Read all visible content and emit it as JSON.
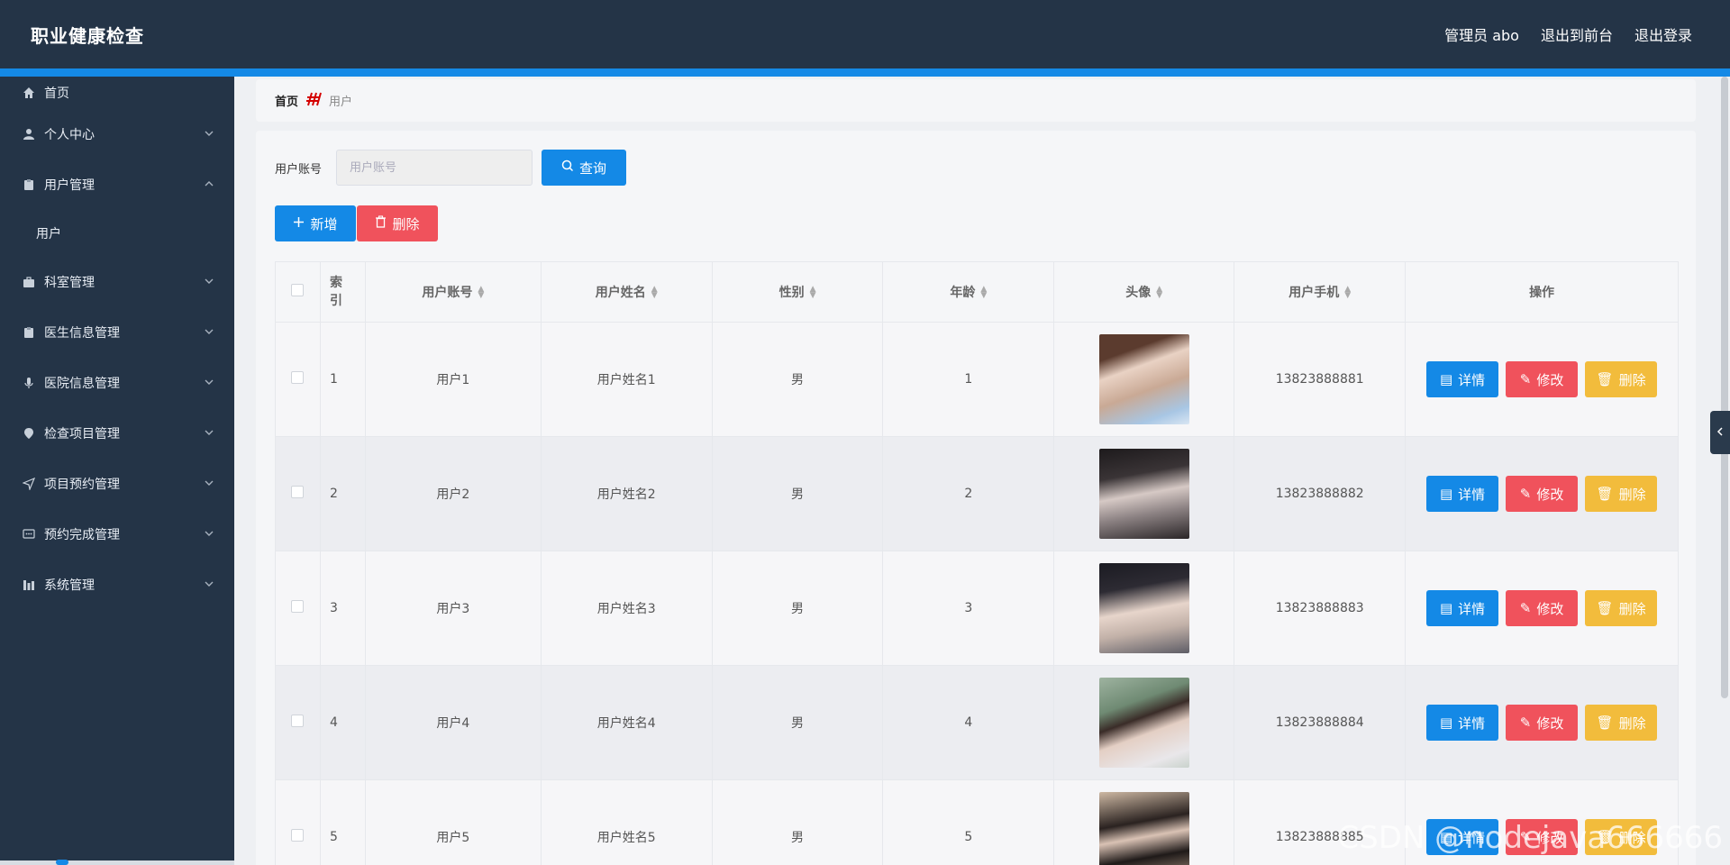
{
  "header": {
    "title": "职业健康检查",
    "admin_label": "管理员 abo",
    "exit_front_label": "退出到前台",
    "logout_label": "退出登录",
    "accent_color": "#1489e6",
    "bg_color": "#243447"
  },
  "sidebar": {
    "items": [
      {
        "label": "首页",
        "icon": "home-icon"
      },
      {
        "label": "个人中心",
        "icon": "user-icon"
      },
      {
        "label": "用户管理",
        "icon": "clipboard-icon"
      },
      {
        "label": "用户",
        "icon": ""
      },
      {
        "label": "科室管理",
        "icon": "briefcase-icon"
      },
      {
        "label": "医生信息管理",
        "icon": "clipboard-icon"
      },
      {
        "label": "医院信息管理",
        "icon": "microphone-icon"
      },
      {
        "label": "检查项目管理",
        "icon": "location-icon"
      },
      {
        "label": "项目预约管理",
        "icon": "send-icon"
      },
      {
        "label": "预约完成管理",
        "icon": "message-icon"
      },
      {
        "label": "系统管理",
        "icon": "chart-icon"
      }
    ]
  },
  "breadcrumb": {
    "home": "首页",
    "current": "用户"
  },
  "search": {
    "label": "用户账号",
    "placeholder": "用户账号",
    "value": "",
    "query_label": "查询"
  },
  "actions": {
    "add_label": "新增",
    "delete_label": "删除"
  },
  "table": {
    "headers": [
      "索引",
      "用户账号",
      "用户姓名",
      "性别",
      "年龄",
      "头像",
      "用户手机",
      "操作"
    ],
    "rows": [
      {
        "index": "1",
        "account": "用户1",
        "name": "用户姓名1",
        "gender": "男",
        "age": "1",
        "phone": "13823888881"
      },
      {
        "index": "2",
        "account": "用户2",
        "name": "用户姓名2",
        "gender": "男",
        "age": "2",
        "phone": "13823888882"
      },
      {
        "index": "3",
        "account": "用户3",
        "name": "用户姓名3",
        "gender": "男",
        "age": "3",
        "phone": "13823888883"
      },
      {
        "index": "4",
        "account": "用户4",
        "name": "用户姓名4",
        "gender": "男",
        "age": "4",
        "phone": "13823888884"
      },
      {
        "index": "5",
        "account": "用户5",
        "name": "用户姓名5",
        "gender": "男",
        "age": "5",
        "phone": "13823888885"
      }
    ],
    "detail_label": "详情",
    "edit_label": "修改",
    "remove_label": "删除"
  },
  "watermark": "CSDN @nodejava666666"
}
